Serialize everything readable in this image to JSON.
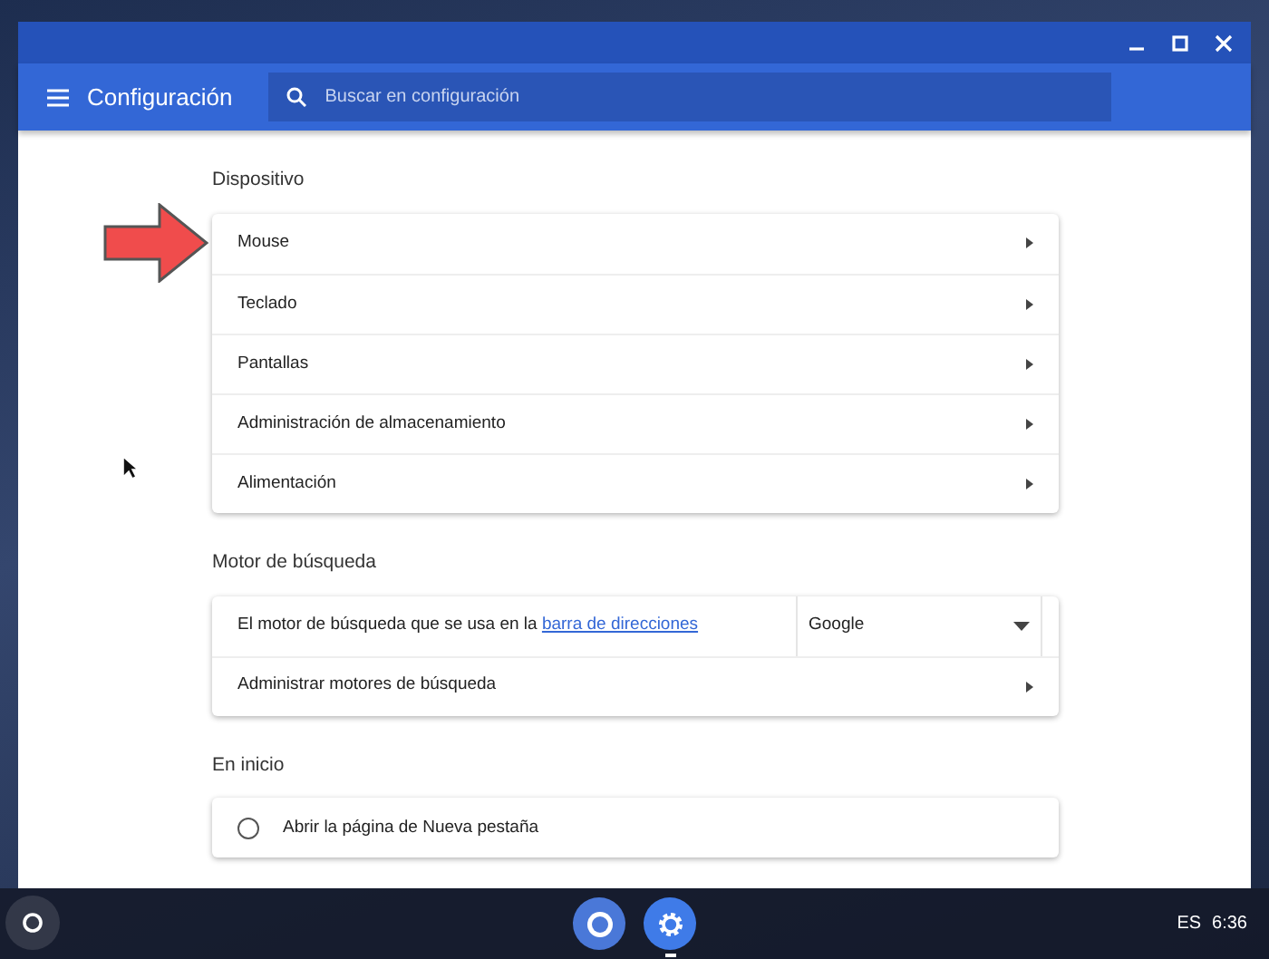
{
  "window": {
    "controls": [
      {
        "kind": "minimize"
      },
      {
        "kind": "maximize"
      },
      {
        "kind": "close"
      }
    ]
  },
  "header": {
    "title": "Configuración",
    "search": {
      "placeholder": "Buscar en configuración"
    }
  },
  "sections": [
    {
      "title": "Dispositivo",
      "rows": [
        {
          "kind": "link",
          "label": "Mouse"
        },
        {
          "kind": "link",
          "label": "Teclado"
        },
        {
          "kind": "link",
          "label": "Pantallas"
        },
        {
          "kind": "link",
          "label": "Administración de almacenamiento"
        },
        {
          "kind": "link",
          "label": "Alimentación"
        }
      ]
    },
    {
      "title": "Motor de búsqueda",
      "rows": [
        {
          "kind": "select",
          "label": "El motor de búsqueda que se usa en la ",
          "link": "barra de direcciones",
          "value": "Google"
        },
        {
          "kind": "link",
          "label": "Administrar motores de búsqueda"
        }
      ]
    },
    {
      "title": "En inicio",
      "rows": [
        {
          "kind": "radio",
          "label": "Abrir la página de Nueva pestaña",
          "selected": false
        }
      ]
    }
  ],
  "shelf": {
    "apps": [
      {
        "kind": "browser",
        "active": false
      },
      {
        "kind": "settings",
        "active": true
      }
    ],
    "language": "ES",
    "time": "6:36"
  }
}
